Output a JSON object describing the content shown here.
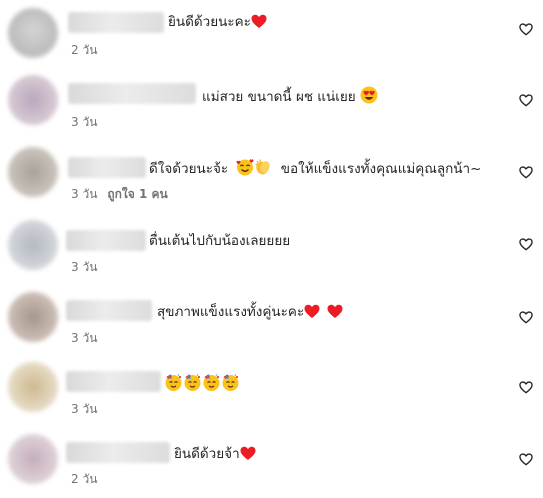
{
  "comments": [
    {
      "text": "ยินดีด้วยนะคะ",
      "emoji": [
        "red-heart"
      ],
      "time": "2 วัน",
      "likes": "",
      "avatar_color": "#bdbdbd"
    },
    {
      "text": "แม่สวย ขนาดนี้ ผช แน่เยย",
      "emoji": [
        "heart-eyes"
      ],
      "time": "3 วัน",
      "likes": "",
      "avatar_color": "#c7b8c7"
    },
    {
      "text": "ดีใจด้วยนะจ้ะ",
      "emoji": [
        "smiling-hearts",
        "clapping-hands"
      ],
      "text_after": "ขอให้แข็งแรงทั้งคุณแม่คุณลูกน้า~",
      "time": "3 วัน",
      "likes": "ถูกใจ 1 คน",
      "avatar_color": "#bdb6ad"
    },
    {
      "text": "ตื่นเต้นไปกับน้องเลยยยย",
      "emoji": [],
      "time": "3 วัน",
      "likes": "",
      "avatar_color": "#c3c6cc"
    },
    {
      "text": "สุขภาพแข็งแรงทั้งคู่นะคะ",
      "emoji": [
        "red-heart",
        "red-heart"
      ],
      "time": "3 วัน",
      "likes": "",
      "avatar_color": "#bfb0a8"
    },
    {
      "text": "",
      "emoji": [
        "party-face",
        "party-face",
        "party-face",
        "party-face"
      ],
      "time": "3 วัน",
      "likes": "",
      "avatar_color": "#d8cbb0"
    },
    {
      "text": "ยินดีด้วยจ้า",
      "emoji": [
        "red-heart"
      ],
      "time": "2 วัน",
      "likes": "",
      "avatar_color": "#d4c3cc"
    }
  ],
  "icons": {
    "like": "heart-outline-icon"
  },
  "colors": {
    "text": "#262626",
    "meta": "#737373",
    "heart": "#ed1c24"
  }
}
